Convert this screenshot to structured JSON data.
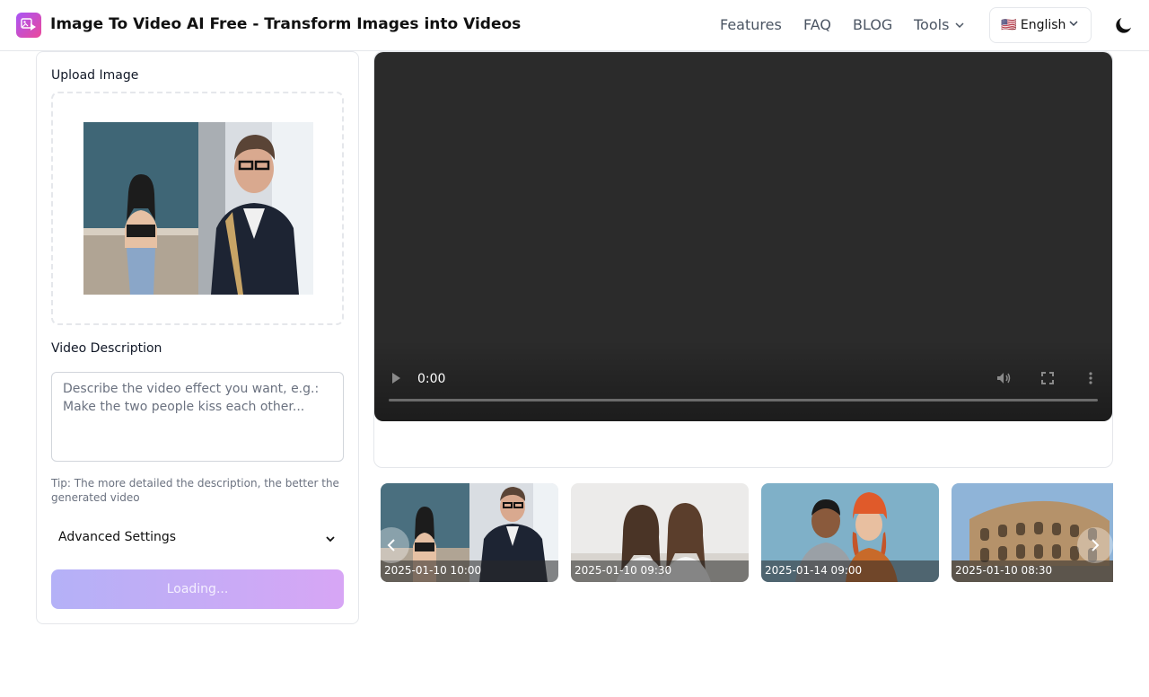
{
  "header": {
    "title": "Image To Video AI Free - Transform Images into Videos",
    "nav": {
      "features": "Features",
      "faq": "FAQ",
      "blog": "BLOG",
      "tools": "Tools"
    },
    "language": "🇺🇸 English",
    "icons": [
      "app-logo-icon",
      "chevron-down-icon",
      "moon-icon"
    ]
  },
  "left": {
    "upload_label": "Upload Image",
    "description_label": "Video Description",
    "description_placeholder": "Describe the video effect you want, e.g.: Make the two people kiss each other...",
    "description_value": "",
    "tip": "Tip: The more detailed the description, the better the generated video",
    "advanced_settings": "Advanced Settings",
    "submit_label": "Loading..."
  },
  "video": {
    "time": "0:00",
    "icons": [
      "play-icon",
      "volume-icon",
      "fullscreen-icon",
      "more-options-icon"
    ]
  },
  "gallery": {
    "items": [
      {
        "timestamp": "2025-01-10 10:00"
      },
      {
        "timestamp": "2025-01-10 09:30"
      },
      {
        "timestamp": "2025-01-14 09:00"
      },
      {
        "timestamp": "2025-01-10 08:30"
      }
    ],
    "icons": [
      "chevron-left-icon",
      "chevron-right-icon"
    ]
  },
  "colors": {
    "brand_gradient_start": "#a855f7",
    "brand_gradient_end": "#ec4899",
    "button_gradient_start": "#b4b1f7",
    "button_gradient_end": "#d7a6f5",
    "video_background": "#2b2b2b"
  }
}
